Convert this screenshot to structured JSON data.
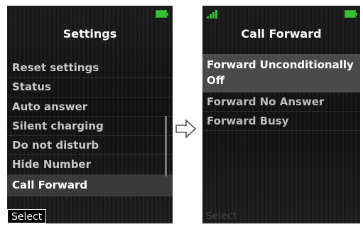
{
  "colors": {
    "battery": "#35c235",
    "signal": "#35c235",
    "selected_bg_left": "#3a3a3a",
    "selected_bg_right": "#4a4a4a",
    "screen_bg": "#151515"
  },
  "left_screen": {
    "title": "Settings",
    "status_icons": [
      "battery-icon"
    ],
    "menu_items": [
      {
        "label": "Reset settings"
      },
      {
        "label": "Status"
      },
      {
        "label": "Auto answer"
      },
      {
        "label": "Silent charging"
      },
      {
        "label": "Do not disturb"
      },
      {
        "label": "Hide Number"
      },
      {
        "label": "Call Forward",
        "selected": true
      }
    ],
    "softkey_left": "Select"
  },
  "transition_icon": "right-arrow-icon",
  "right_screen": {
    "title": "Call Forward",
    "status_icons": [
      "signal-icon",
      "battery-icon"
    ],
    "selected_item": {
      "label": "Forward Unconditionally",
      "value": "Off"
    },
    "menu_items": [
      {
        "label": "Forward No Answer"
      },
      {
        "label": "Forward Busy"
      }
    ],
    "softkey_left": "Select"
  }
}
